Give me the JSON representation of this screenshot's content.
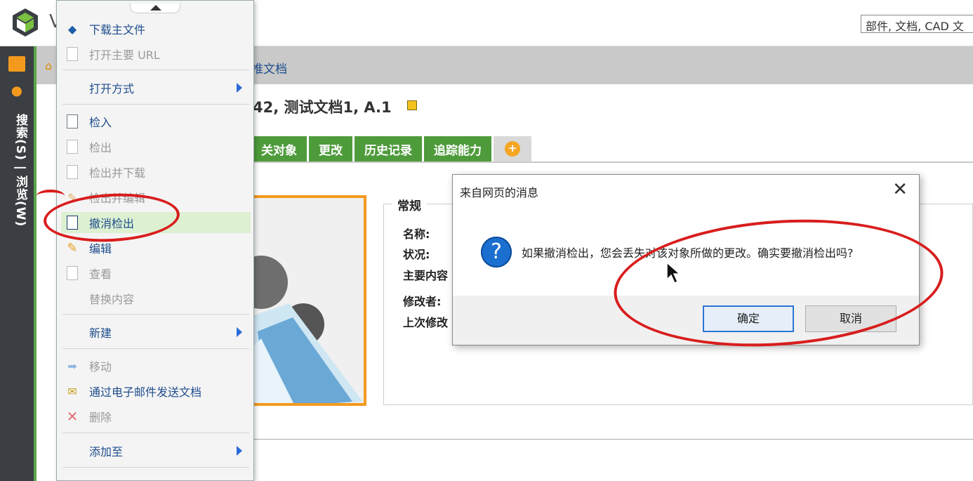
{
  "header": {
    "app_initial": "V",
    "search_placeholder": "部件, 文档, CAD 文"
  },
  "rail": {
    "label": "搜索(S) | 浏览(W)"
  },
  "breadcrumb": {
    "text": "推文档"
  },
  "document": {
    "title": "42, 测试文档1, A.1"
  },
  "tabs": [
    {
      "label": "关对象"
    },
    {
      "label": "更改"
    },
    {
      "label": "历史记录"
    },
    {
      "label": "追踪能力"
    }
  ],
  "panel": {
    "legend": "常规",
    "fields": [
      "名称:",
      "状况:",
      "主要内容",
      "修改者:",
      "上次修改"
    ]
  },
  "context_menu": {
    "items": [
      {
        "label": "下载主文件",
        "disabled": false,
        "icon": "download-icon"
      },
      {
        "label": "打开主要 URL",
        "disabled": true,
        "icon": "open-url-icon"
      },
      {
        "label": "打开方式",
        "disabled": false,
        "submenu": true
      },
      {
        "label": "检入",
        "disabled": false,
        "icon": "check-in-icon"
      },
      {
        "label": "检出",
        "disabled": true,
        "icon": "check-out-icon"
      },
      {
        "label": "检出并下载",
        "disabled": true,
        "icon": "check-out-download-icon"
      },
      {
        "label": "检出并编辑",
        "disabled": true,
        "icon": "check-out-edit-icon"
      },
      {
        "label": "撤消检出",
        "disabled": false,
        "icon": "undo-check-out-icon",
        "highlighted": true
      },
      {
        "label": "编辑",
        "disabled": false,
        "icon": "edit-icon"
      },
      {
        "label": "查看",
        "disabled": true,
        "icon": "view-icon"
      },
      {
        "label": "替换内容",
        "disabled": true
      },
      {
        "label": "新建",
        "disabled": false,
        "submenu": true
      },
      {
        "label": "移动",
        "disabled": true,
        "icon": "move-icon"
      },
      {
        "label": "通过电子邮件发送文档",
        "disabled": false,
        "icon": "email-icon"
      },
      {
        "label": "删除",
        "disabled": true,
        "icon": "delete-icon"
      },
      {
        "label": "添加至",
        "disabled": false,
        "submenu": true
      }
    ]
  },
  "dialog": {
    "title": "来自网页的消息",
    "message": "如果撤消检出，您会丢失对该对象所做的更改。确实要撤消检出吗?",
    "ok_label": "确定",
    "cancel_label": "取消"
  },
  "colors": {
    "tab_green": "#4e9b3b",
    "accent_orange": "#f39a1e",
    "annotation_red": "#d81d1d",
    "link_blue": "#1e4d8c"
  }
}
